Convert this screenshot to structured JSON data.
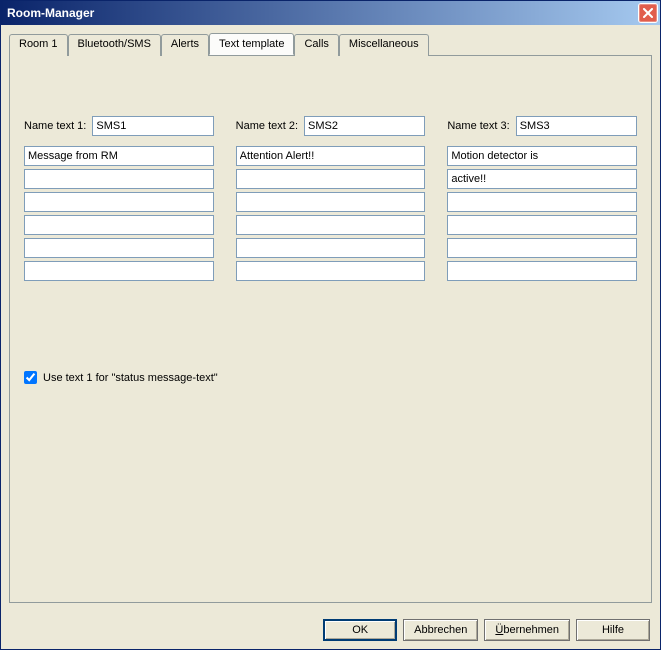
{
  "window": {
    "title": "Room-Manager"
  },
  "tabs": [
    {
      "label": "Room 1"
    },
    {
      "label": "Bluetooth/SMS"
    },
    {
      "label": "Alerts"
    },
    {
      "label": "Text template"
    },
    {
      "label": "Calls"
    },
    {
      "label": "Miscellaneous"
    }
  ],
  "active_tab_index": 3,
  "columns": [
    {
      "name_label": "Name text 1:",
      "name_value": "SMS1",
      "lines": [
        "Message from RM",
        "",
        "",
        "",
        "",
        ""
      ]
    },
    {
      "name_label": "Name text 2:",
      "name_value": "SMS2",
      "lines": [
        "Attention Alert!!",
        "",
        "",
        "",
        "",
        ""
      ]
    },
    {
      "name_label": "Name text 3:",
      "name_value": "SMS3",
      "lines": [
        "Motion detector is",
        "active!!",
        "",
        "",
        "",
        ""
      ]
    }
  ],
  "checkbox": {
    "checked": true,
    "label": "Use text 1 for \"status message-text\""
  },
  "buttons": {
    "ok": "OK",
    "cancel": "Abbrechen",
    "apply_prefix": "Ü",
    "apply_rest": "bernehmen",
    "help": "Hilfe"
  }
}
